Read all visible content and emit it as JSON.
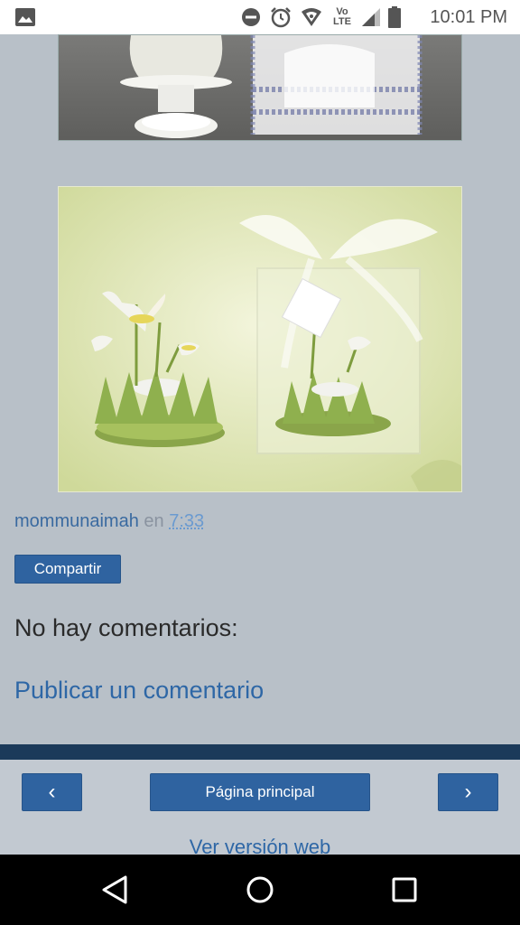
{
  "status_bar": {
    "time": "10:01 PM",
    "icons": [
      "gallery-icon",
      "do-not-disturb-icon",
      "alarm-icon",
      "hotspot-icon",
      "volte-icon",
      "signal-icon",
      "battery-icon"
    ],
    "volte_label": "Vo LTE"
  },
  "post": {
    "author": "mommunaimah",
    "en": "en",
    "time": "7:33",
    "share_label": "Compartir",
    "no_comments": "No hay comentarios:",
    "post_comment": "Publicar un comentario"
  },
  "footer": {
    "prev_label": "‹",
    "home_label": "Página principal",
    "next_label": "›",
    "web_version": "Ver versión web"
  },
  "colors": {
    "background": "#b8c0c8",
    "button": "#2f63a0",
    "link": "#2e67a6",
    "footer_bar": "#1b3a5a"
  }
}
